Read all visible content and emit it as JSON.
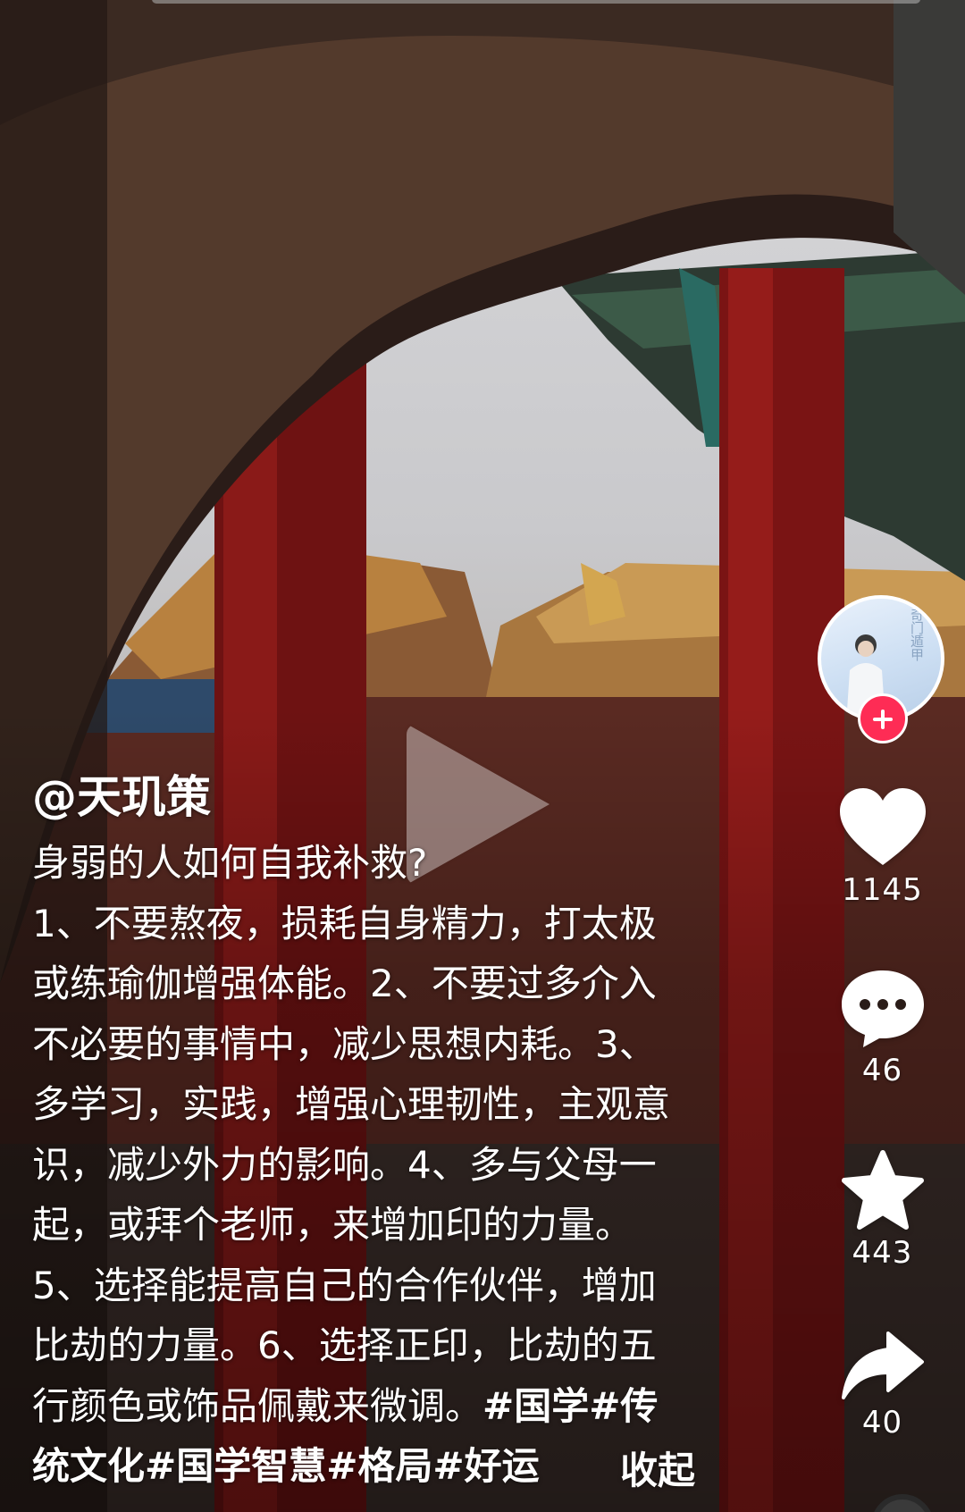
{
  "video": {
    "author_handle": "@天玑策",
    "caption_lines": [
      "身弱的人如何自我补救?",
      "1、不要熬夜，损耗自身精力，打太极",
      "或练瑜伽增强体能。2、不要过多介入",
      "不必要的事情中，减少思想内耗。3、",
      "多学习，实践，增强心理韧性，主观意",
      "识，减少外力的影响。4、多与父母一",
      "起，或拜个老师，来增加印的力量。",
      "5、选择能提高自己的合作伙伴，增加",
      "比劫的力量。6、选择正印，比劫的五"
    ],
    "caption_line_with_tags_prefix": "行颜色或饰品佩戴来微调。",
    "caption_line_with_tags_suffix": "#国学#传",
    "caption_tags_line": "统文化#国学智慧#格局#好运",
    "collapse_label": "收起"
  },
  "avatar": {
    "overlay_text": "奇门遁甲"
  },
  "actions": {
    "like_count": "1145",
    "comment_count": "46",
    "favorite_count": "443",
    "share_count": "40"
  },
  "colors": {
    "follow_badge": "#fe2c55",
    "text": "#ffffff"
  },
  "icons": [
    "play-icon",
    "heart-icon",
    "comment-icon",
    "star-icon",
    "share-icon",
    "plus-icon"
  ]
}
